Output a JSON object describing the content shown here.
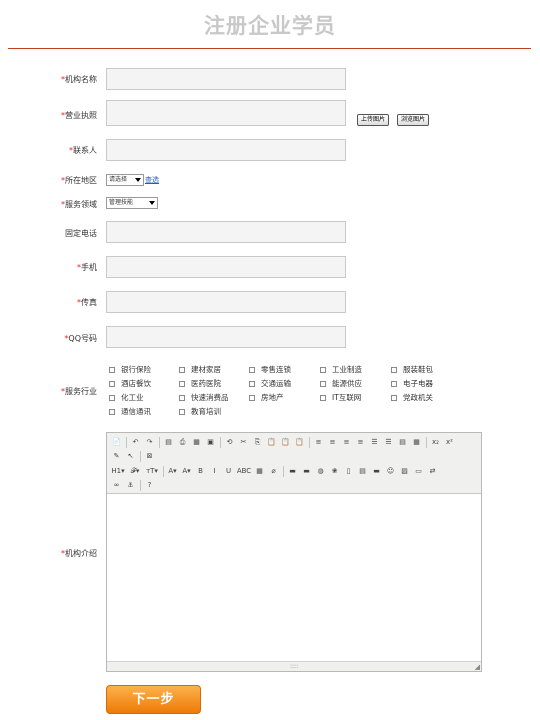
{
  "page_title": "注册企业学员",
  "required_mark": "*",
  "form": {
    "org_name_label": "机构名称",
    "license_label": "营业执照",
    "upload_label": "上传图片",
    "browse_label": "浏览图片",
    "contact_label": "联系人",
    "region_label": "所在地区",
    "region_select": "请选择",
    "region_link": "查选",
    "service_field_label": "服务领域",
    "service_field_select": "管理技能",
    "phone_label": "固定电话",
    "mobile_label": "手机",
    "fax_label": "传真",
    "qq_label": "QQ号码",
    "industry_label": "服务行业",
    "intro_label": "机构介绍"
  },
  "industries": [
    [
      "银行保险",
      "建材家居",
      "零售连锁",
      "工业制造",
      "服装鞋包"
    ],
    [
      "酒店餐饮",
      "医药医院",
      "交通运输",
      "能源供应",
      "电子电器"
    ],
    [
      "化工业",
      "快速消费品",
      "房地产",
      "IT互联网",
      "党政机关"
    ],
    [
      "通信通讯",
      "教育培训"
    ]
  ],
  "editor": {
    "toolbar_row1": [
      "📄",
      "↶",
      "↷",
      "▤",
      "⎙",
      "▦",
      "▣",
      "⟲",
      "✂",
      "⎘",
      "📋",
      "📋",
      "📋",
      "≡",
      "≡",
      "≡",
      "≡",
      "☰",
      "☰",
      "▤",
      "▦",
      "x₂",
      "x²"
    ],
    "toolbar_row2": [
      "✎",
      "↖",
      "⊠"
    ],
    "toolbar_row3": [
      "H1▾",
      "𝓕▾",
      "тT▾",
      "A▾",
      "A▾",
      "B",
      "I",
      "U",
      "ABC",
      "▦",
      "⌀",
      "▬",
      "▬",
      "◍",
      "❀",
      "▯",
      "▤",
      "▬",
      "☺",
      "▨",
      "▭",
      "⇄"
    ],
    "toolbar_row4": [
      "∞",
      "⚓",
      "?"
    ],
    "grip": "::::",
    "corner": "◢"
  },
  "next_button": "下一步",
  "colors": {
    "title": "#c8c8c8",
    "rule": "#c0411e",
    "required": "#e0261a",
    "button_top": "#fcb24b",
    "button_bottom": "#ed7a08"
  }
}
